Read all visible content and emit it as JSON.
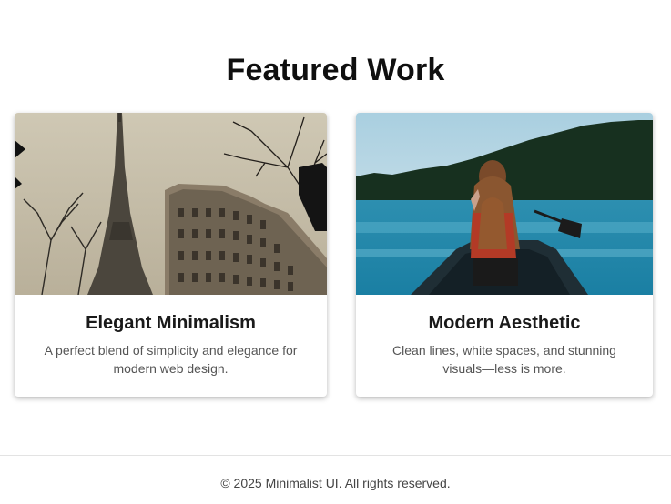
{
  "page": {
    "title": "Featured Work"
  },
  "cards": [
    {
      "title": "Elegant Minimalism",
      "description": "A perfect blend of simplicity and elegance for modern web design.",
      "image_subject": "eiffel-tower-paris-photo"
    },
    {
      "title": "Modern Aesthetic",
      "description": "Clean lines, white spaces, and stunning visuals—less is more.",
      "image_subject": "woman-in-canoe-on-lake-photo"
    }
  ],
  "footer": {
    "text": "© 2025 Minimalist UI. All rights reserved."
  }
}
